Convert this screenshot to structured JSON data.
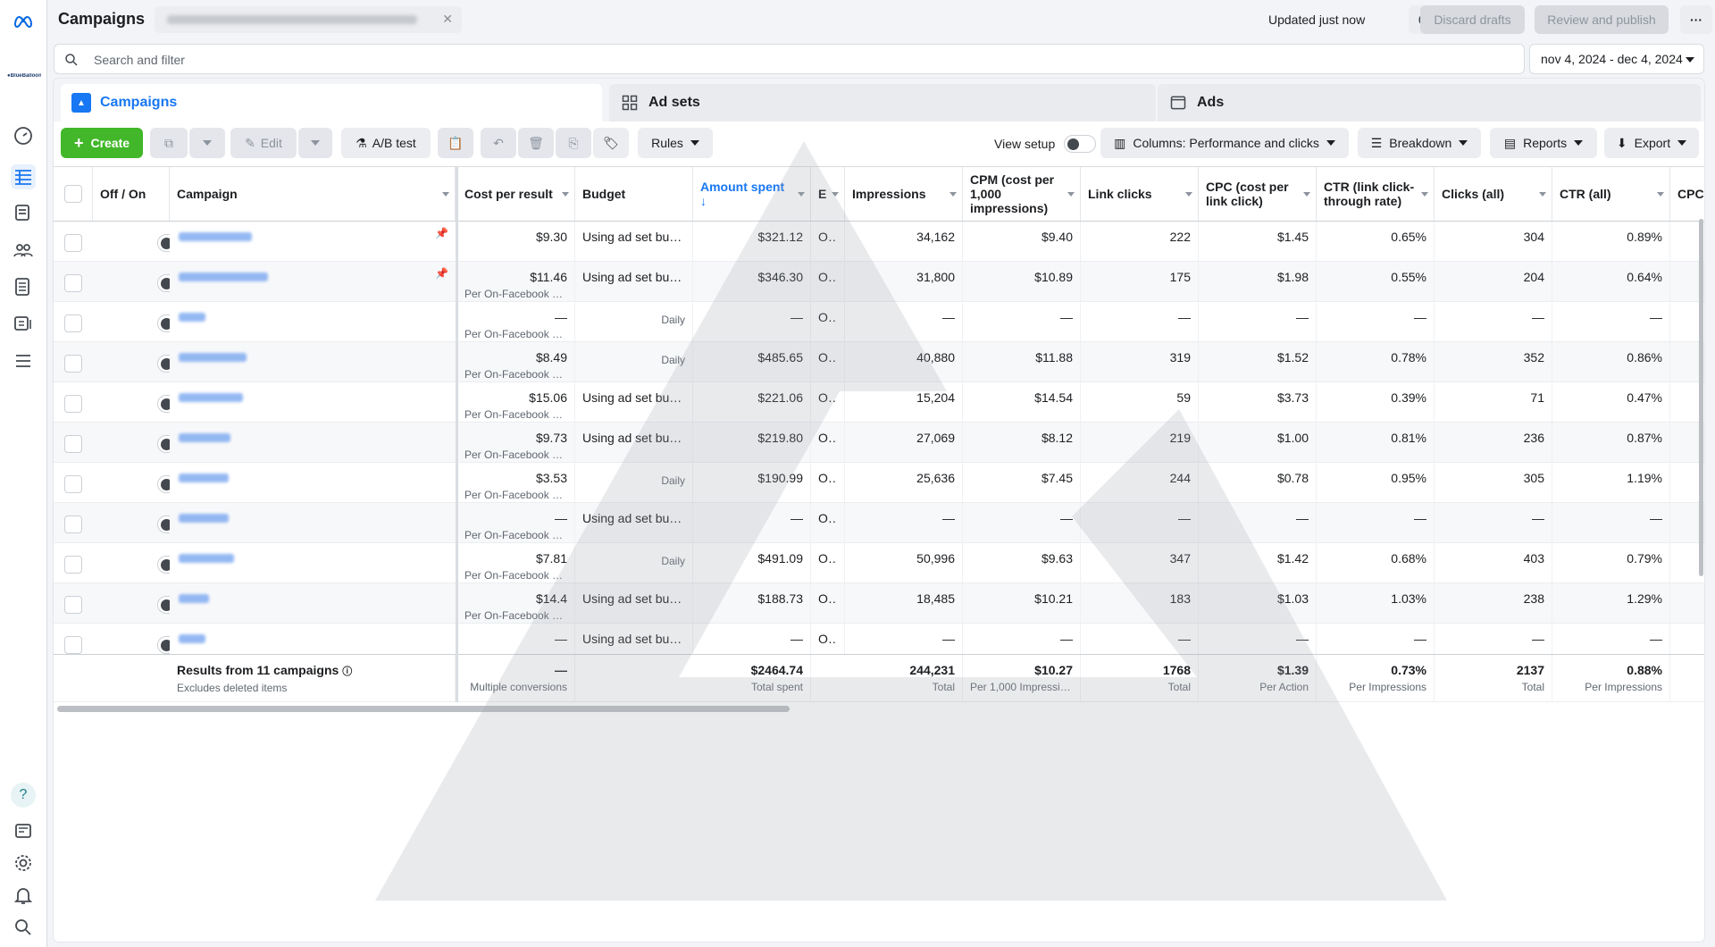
{
  "topbar": {
    "title": "Campaigns",
    "updated": "Updated just now",
    "discard_drafts": "Discard drafts",
    "review_publish": "Review and publish",
    "more": "···"
  },
  "search": {
    "placeholder": "Search and filter"
  },
  "date_range": "nov 4, 2024 - dec 4, 2024",
  "tabs": {
    "campaigns": "Campaigns",
    "ad_sets": "Ad sets",
    "ads": "Ads"
  },
  "toolbar": {
    "create": "Create",
    "edit": "Edit",
    "ab_test": "A/B test",
    "rules": "Rules",
    "view_setup": "View setup",
    "columns": "Columns: Performance and clicks",
    "breakdown": "Breakdown",
    "reports": "Reports",
    "export": "Export"
  },
  "table": {
    "headers": {
      "off_on": "Off / On",
      "campaign": "Campaign",
      "cost_per_result": "Cost per result",
      "budget": "Budget",
      "amount_spent": "Amount spent",
      "e": "E",
      "impressions": "Impressions",
      "cpm": "CPM (cost per 1,000 impressions)",
      "link_clicks": "Link clicks",
      "cpc_link": "CPC (cost per link click)",
      "ctr_link": "CTR (link click-through rate)",
      "clicks_all": "Clicks (all)",
      "ctr_all": "CTR (all)",
      "cpc": "CPC"
    },
    "rows": [
      {
        "cpr": "$9.30",
        "cpr_sub": "",
        "budget": "Using ad set bud...",
        "budget_sub": "",
        "spent": "$321.12",
        "e": "O...",
        "impr": "34,162",
        "cpm": "$9.40",
        "lc": "222",
        "cpc": "$1.45",
        "ctr": "0.65%",
        "clicks": "304",
        "ctr_all": "0.89%"
      },
      {
        "cpr": "$11.46",
        "cpr_sub": "Per On-Facebook Le...",
        "budget": "Using ad set bud...",
        "budget_sub": "",
        "spent": "$346.30",
        "e": "O...",
        "impr": "31,800",
        "cpm": "$10.89",
        "lc": "175",
        "cpc": "$1.98",
        "ctr": "0.55%",
        "clicks": "204",
        "ctr_all": "0.64%"
      },
      {
        "cpr": "—",
        "cpr_sub": "Per On-Facebook Le...",
        "budget": "",
        "budget_sub": "Daily",
        "spent": "—",
        "e": "O...",
        "impr": "—",
        "cpm": "—",
        "lc": "—",
        "cpc": "—",
        "ctr": "—",
        "clicks": "—",
        "ctr_all": "—"
      },
      {
        "cpr": "$8.49",
        "cpr_sub": "Per On-Facebook Le...",
        "budget": "",
        "budget_sub": "Daily",
        "spent": "$485.65",
        "e": "O...",
        "impr": "40,880",
        "cpm": "$11.88",
        "lc": "319",
        "cpc": "$1.52",
        "ctr": "0.78%",
        "clicks": "352",
        "ctr_all": "0.86%"
      },
      {
        "cpr": "$15.06",
        "cpr_sub": "Per On-Facebook Le...",
        "budget": "Using ad set bud...",
        "budget_sub": "",
        "spent": "$221.06",
        "e": "O...",
        "impr": "15,204",
        "cpm": "$14.54",
        "lc": "59",
        "cpc": "$3.73",
        "ctr": "0.39%",
        "clicks": "71",
        "ctr_all": "0.47%"
      },
      {
        "cpr": "$9.73",
        "cpr_sub": "Per On-Facebook Le...",
        "budget": "Using ad set bud...",
        "budget_sub": "",
        "spent": "$219.80",
        "e": "O...",
        "impr": "27,069",
        "cpm": "$8.12",
        "lc": "219",
        "cpc": "$1.00",
        "ctr": "0.81%",
        "clicks": "236",
        "ctr_all": "0.87%"
      },
      {
        "cpr": "$3.53",
        "cpr_sub": "Per On-Facebook Le...",
        "budget": "",
        "budget_sub": "Daily",
        "spent": "$190.99",
        "e": "O...",
        "impr": "25,636",
        "cpm": "$7.45",
        "lc": "244",
        "cpc": "$0.78",
        "ctr": "0.95%",
        "clicks": "305",
        "ctr_all": "1.19%"
      },
      {
        "cpr": "—",
        "cpr_sub": "Per On-Facebook Le...",
        "budget": "Using ad set bud...",
        "budget_sub": "",
        "spent": "—",
        "e": "O...",
        "impr": "—",
        "cpm": "—",
        "lc": "—",
        "cpc": "—",
        "ctr": "—",
        "clicks": "—",
        "ctr_all": "—"
      },
      {
        "cpr": "$7.81",
        "cpr_sub": "Per On-Facebook Le...",
        "budget": "",
        "budget_sub": "Daily",
        "spent": "$491.09",
        "e": "O...",
        "impr": "50,996",
        "cpm": "$9.63",
        "lc": "347",
        "cpc": "$1.42",
        "ctr": "0.68%",
        "clicks": "403",
        "ctr_all": "0.79%"
      },
      {
        "cpr": "$14.4",
        "cpr_sub": "Per On-Facebook Le...",
        "budget": "Using ad set bud...",
        "budget_sub": "",
        "spent": "$188.73",
        "e": "O...",
        "impr": "18,485",
        "cpm": "$10.21",
        "lc": "183",
        "cpc": "$1.03",
        "ctr": "1.03%",
        "clicks": "238",
        "ctr_all": "1.29%"
      },
      {
        "cpr": "—",
        "cpr_sub": "",
        "budget": "Using ad set bud...",
        "budget_sub": "",
        "spent": "—",
        "e": "O...",
        "impr": "—",
        "cpm": "—",
        "lc": "—",
        "cpc": "—",
        "ctr": "—",
        "clicks": "—",
        "ctr_all": "—"
      }
    ],
    "summary": {
      "label": "Results from 11 campaigns",
      "label_sub": "Excludes deleted items",
      "cpr": "—",
      "cpr_sub": "Multiple conversions",
      "spent": "$2464.74",
      "spent_sub": "Total spent",
      "impr": "244,231",
      "impr_sub": "Total",
      "cpm": "$10.27",
      "cpm_sub": "Per 1,000 Impressio...",
      "lc": "1768",
      "lc_sub": "Total",
      "cpc": "$1.39",
      "cpc_sub": "Per Action",
      "ctr": "0.73%",
      "ctr_sub": "Per Impressions",
      "clicks": "2137",
      "clicks_sub": "Total",
      "ctr_all": "0.88%",
      "ctr_all_sub": "Per Impressions"
    }
  },
  "colors": {
    "accent": "#1877f2",
    "create": "#42b72a"
  }
}
